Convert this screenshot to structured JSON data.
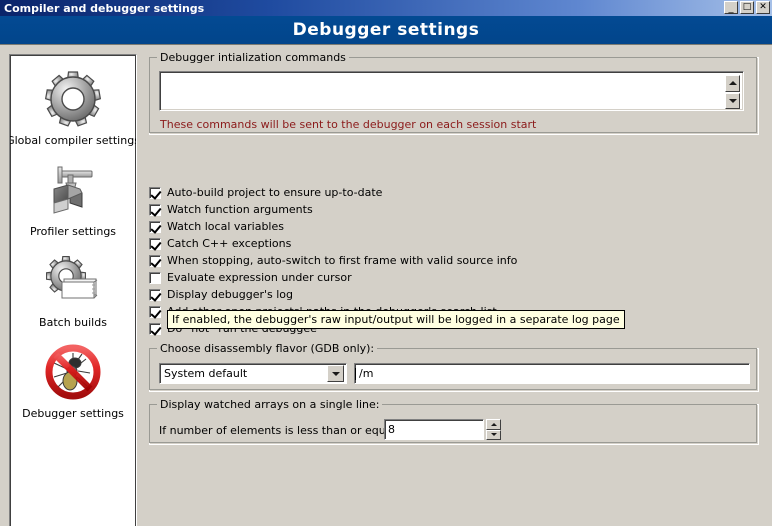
{
  "window": {
    "title": "Compiler and debugger settings",
    "buttons": {
      "minimize": "_",
      "maximize": "□",
      "close": "✕"
    }
  },
  "banner": {
    "title": "Debugger settings"
  },
  "sidebar": {
    "items": [
      {
        "label": "Global compiler settings",
        "icon": "gear-icon"
      },
      {
        "label": "Profiler settings",
        "icon": "caliper-blocks-icon"
      },
      {
        "label": "Batch builds",
        "icon": "gear-documents-icon"
      },
      {
        "label": "Debugger settings",
        "icon": "no-bug-icon"
      }
    ]
  },
  "init_commands_group": {
    "title": "Debugger intialization commands",
    "textarea_value": "",
    "note": "These commands will be sent to the debugger on each session start",
    "scroll_up": "▲",
    "scroll_down": "▼"
  },
  "options": [
    {
      "label": "Auto-build project to ensure up-to-date",
      "checked": true
    },
    {
      "label": "Watch function arguments",
      "checked": true
    },
    {
      "label": "Watch local variables",
      "checked": true
    },
    {
      "label": "Catch C++ exceptions",
      "checked": true
    },
    {
      "label": "When stopping, auto-switch to first frame with valid source info",
      "checked": true
    },
    {
      "label": "Evaluate expression under cursor",
      "checked": false
    },
    {
      "label": "Display debugger's log",
      "checked": true
    },
    {
      "label": "Add other open projects' paths in the debugger's search list",
      "checked": true
    },
    {
      "label": "Do *not* run the debuggee",
      "checked": true
    }
  ],
  "tooltip": {
    "text": "If enabled, the debugger's raw input/output will be logged in a separate log page"
  },
  "disassembly_group": {
    "title": "Choose disassembly flavor (GDB only):",
    "combo_value": "System default",
    "flags_value": "/m"
  },
  "arrays_group": {
    "title": "Display watched arrays on a single line:",
    "label": "If number of elements is less than or equal to:",
    "value": "8"
  },
  "colors": {
    "face": "#d4d0c8",
    "banner": "#034a93",
    "note_red": "#8b1a1a",
    "tooltip_bg": "#ffffe1"
  }
}
